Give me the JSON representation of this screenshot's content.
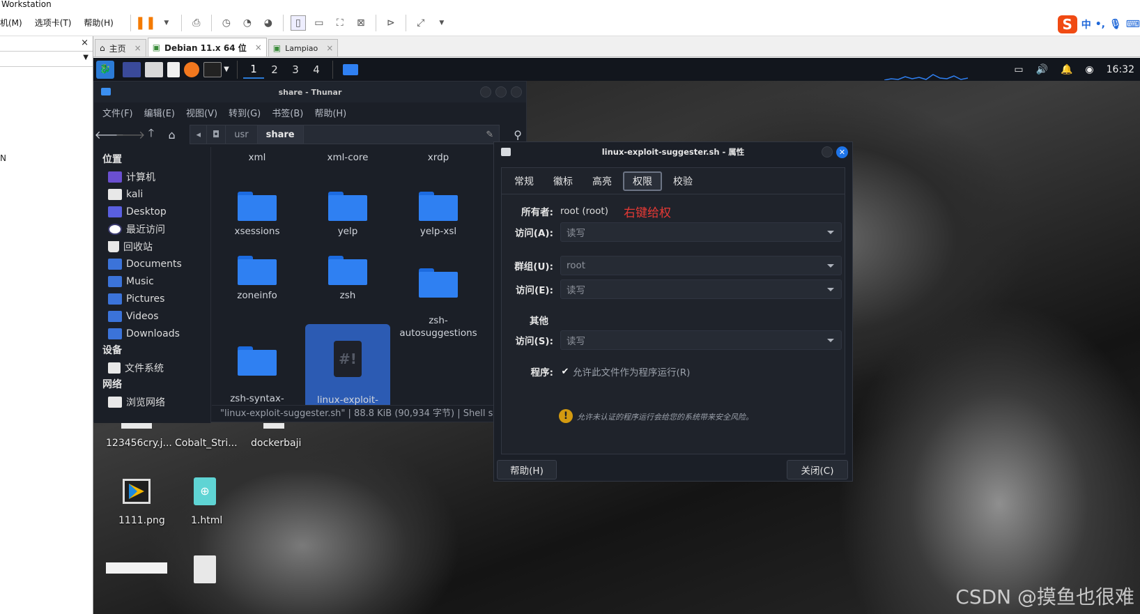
{
  "host": {
    "title": "Workstation",
    "menus": [
      "机(M)",
      "选项卡(T)",
      "帮助(H)"
    ],
    "ime": {
      "logo": "S",
      "lang": "中",
      "punct": "•,"
    }
  },
  "host_tabs": [
    {
      "label": "主页",
      "close": "×"
    },
    {
      "label": "Debian 11.x 64 位",
      "close": "×"
    },
    {
      "label": "Lampiao",
      "close": "×"
    }
  ],
  "sidebar": {
    "close": "×",
    "letter": "N"
  },
  "panel": {
    "workspaces": [
      "1",
      "2",
      "3",
      "4"
    ],
    "clock": "16:32"
  },
  "thunar": {
    "title": "share - Thunar",
    "menu": [
      "文件(F)",
      "编辑(E)",
      "视图(V)",
      "转到(G)",
      "书签(B)",
      "帮助(H)"
    ],
    "path": [
      "usr",
      "share"
    ],
    "places_header": "位置",
    "places": [
      "计算机",
      "kali",
      "Desktop",
      "最近访问",
      "回收站",
      "Documents",
      "Music",
      "Pictures",
      "Videos",
      "Downloads"
    ],
    "devices_header": "设备",
    "devices": [
      "文件系统"
    ],
    "network_header": "网络",
    "network": [
      "浏览网络"
    ],
    "files": [
      "xml",
      "xml-core",
      "xrdp",
      "xsessions",
      "yelp",
      "yelp-xsl",
      "zoneinfo",
      "zsh",
      "zsh-\nautosuggestions",
      "zsh-syntax-\nhighlighting",
      "linux-exploit-\nsuggester.sh"
    ],
    "script_glyph": "#!",
    "status": "\"linux-exploit-suggester.sh\" | 88.8 KiB (90,934 字节) | Shell sc"
  },
  "desktop": {
    "labels": [
      "123456cry.j...",
      "Cobalt_Stri...",
      "dockerbaji",
      "1111.png",
      "1.html"
    ]
  },
  "props": {
    "title": "linux-exploit-suggester.sh - 属性",
    "tabs": [
      "常规",
      "徽标",
      "高亮",
      "权限",
      "校验"
    ],
    "owner_label": "所有者:",
    "owner_value": "root (root)",
    "annotation": "右键给权",
    "access_a_label": "访问(A):",
    "access_a_value": "读写",
    "group_label": "群组(U):",
    "group_value": "root",
    "access_e_label": "访问(E):",
    "access_e_value": "读写",
    "others_heading": "其他",
    "access_s_label": "访问(S):",
    "access_s_value": "读写",
    "program_label": "程序:",
    "exec_label": "允许此文件作为程序运行(R)",
    "warning": "允许未认证的程序运行会给您的系统带来安全风险。",
    "help_button": "帮助(H)",
    "close_button": "关闭(C)"
  },
  "watermark": "CSDN @摸鱼也很难"
}
